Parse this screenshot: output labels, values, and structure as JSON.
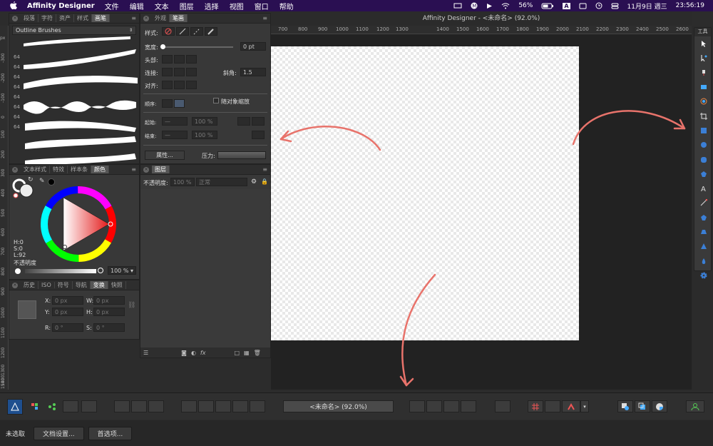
{
  "menubar": {
    "app_name": "Affinity Designer",
    "items": [
      "文件",
      "编辑",
      "文本",
      "图层",
      "选择",
      "视图",
      "窗口",
      "帮助"
    ],
    "battery": "56%",
    "input_method": "A",
    "date": "11月9日 週三",
    "time": "23:56:19"
  },
  "window": {
    "title": "Affinity Designer - <未命名> (92.0%)"
  },
  "ruler": {
    "unit": "px",
    "h_ticks": [
      "700",
      "800",
      "900",
      "1000",
      "1100",
      "1200",
      "1300",
      "1400",
      "1500",
      "1600",
      "1700",
      "1800",
      "1900",
      "2000",
      "2100",
      "2200",
      "2300",
      "2400",
      "2500",
      "2600"
    ],
    "v_ticks": [
      "-300",
      "-200",
      "-100",
      "0",
      "100",
      "200",
      "300",
      "400",
      "500",
      "600",
      "700",
      "800",
      "900",
      "1000",
      "1100",
      "1200",
      "1300",
      "1400",
      "1500"
    ]
  },
  "brushes_panel": {
    "tabs": [
      "段落",
      "字符",
      "资产",
      "样式",
      "画笔"
    ],
    "category": "Outline Brushes",
    "sizes": [
      "64",
      "64",
      "64",
      "64",
      "64",
      "64",
      "64",
      "64"
    ]
  },
  "stroke_panel": {
    "tabs": [
      "外观",
      "笔画"
    ],
    "style_label": "样式:",
    "width_label": "宽度:",
    "width_value": "0 pt",
    "cap_label": "头部:",
    "join_label": "连接:",
    "mitre_label": "斜角:",
    "mitre_value": "1.5",
    "align_label": "对齐:",
    "order_label": "顺序:",
    "scale_label": "随对象缩放",
    "start_label": "起始:",
    "end_label": "结束:",
    "start_value": "100 %",
    "end_value": "100 %",
    "properties_label": "属性...",
    "pressure_label": "压力:"
  },
  "color_panel": {
    "tabs": [
      "文本样式",
      "特效",
      "样本条",
      "颜色"
    ],
    "h_label": "H:",
    "h_value": "0",
    "s_label": "S:",
    "s_value": "0",
    "l_label": "L:",
    "l_value": "92",
    "opacity_label": "不透明度",
    "opacity_value": "100 %"
  },
  "layers_panel": {
    "tabs": [
      "图层"
    ],
    "opacity_label": "不透明度:",
    "opacity_value": "100 %",
    "blend_mode": "正常"
  },
  "transform_panel": {
    "tabs": [
      "历史",
      "ISO",
      "符号",
      "导航",
      "变换",
      "快照"
    ],
    "x_label": "X:",
    "x_value": "0 px",
    "y_label": "Y:",
    "y_value": "0 px",
    "w_label": "W:",
    "w_value": "0 px",
    "h_label": "H:",
    "h_value": "0 px",
    "r_label": "R:",
    "r_value": "0 °",
    "s_label": "S:",
    "s_value": "0 °"
  },
  "tools": {
    "title": "工具",
    "items": [
      "move-tool-icon",
      "node-tool-icon",
      "fill-tool-icon",
      "place-image-tool-icon",
      "transparency-tool-icon",
      "crop-tool-icon",
      "rectangle-tool-icon",
      "ellipse-tool-icon",
      "rounded-rect-tool-icon",
      "polygon-tool-icon",
      "text-tool-icon",
      "pen-tool-icon",
      "pentagon-tool-icon",
      "trapezoid-tool-icon",
      "triangle-tool-icon",
      "teardrop-tool-icon",
      "cog-tool-icon"
    ],
    "accent": "#3b7fd6"
  },
  "toolbar": {
    "doc_label": "<未命名> (92.0%)"
  },
  "status": {
    "selection": "未选取",
    "doc_setup": "文档设置...",
    "preferences": "首选项..."
  },
  "colors": {
    "arrow": "#e8736b",
    "menubar": "#2a0f52"
  }
}
